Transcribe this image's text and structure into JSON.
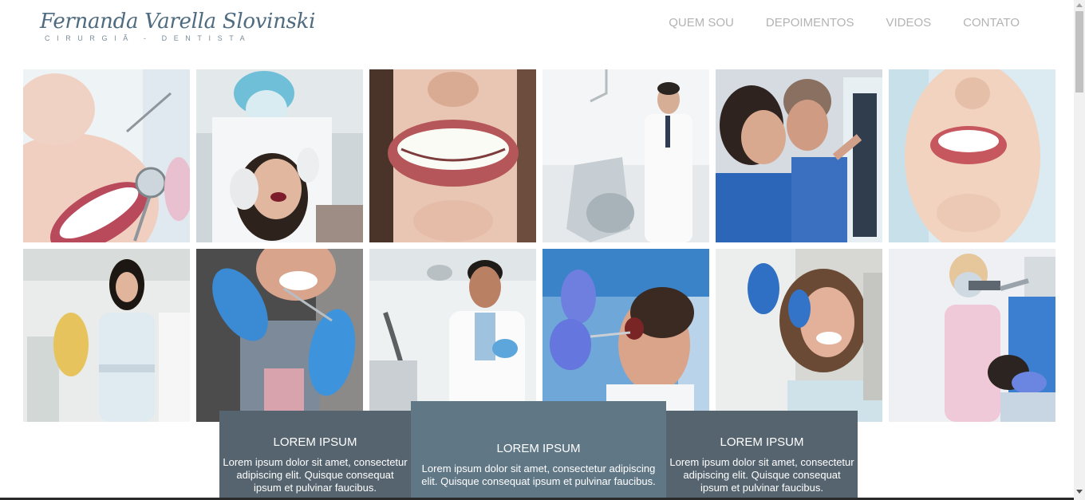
{
  "logo": {
    "name": "Fernanda Varella Slovinski",
    "subtitle": "CIRURGIÃ - DENTISTA"
  },
  "nav": {
    "items": [
      "QUEM SOU",
      "DEPOIMENTOS",
      "VIDEOS",
      "CONTATO"
    ]
  },
  "gallery": {
    "photos": [
      "smile-with-dental-mirror",
      "dentist-treating-patient",
      "close-up-smile",
      "dentist-in-clinic",
      "dentists-viewing-xray",
      "smiling-woman",
      "female-dentist-portrait",
      "patient-gloved-hands",
      "male-dentist-portrait",
      "patient-under-treatment",
      "smiling-female-patient",
      "dentist-with-microscope"
    ]
  },
  "cards": [
    {
      "title": "LOREM IPSUM",
      "text": "Lorem ipsum dolor sit amet, consectetur adipiscing elit. Quisque consequat ipsum et pulvinar faucibus."
    },
    {
      "title": "LOREM IPSUM",
      "text": "Lorem ipsum dolor sit amet, consectetur adipiscing elit. Quisque consequat ipsum et pulvinar faucibus."
    },
    {
      "title": "LOREM IPSUM",
      "text": "Lorem ipsum dolor sit amet, consectetur adipiscing elit. Quisque consequat ipsum et pulvinar faucibus."
    }
  ],
  "colors": {
    "card": "#56646f",
    "card_highlight": "#607786",
    "nav_text": "#b3b3b3",
    "logo": "#4e6b80"
  }
}
